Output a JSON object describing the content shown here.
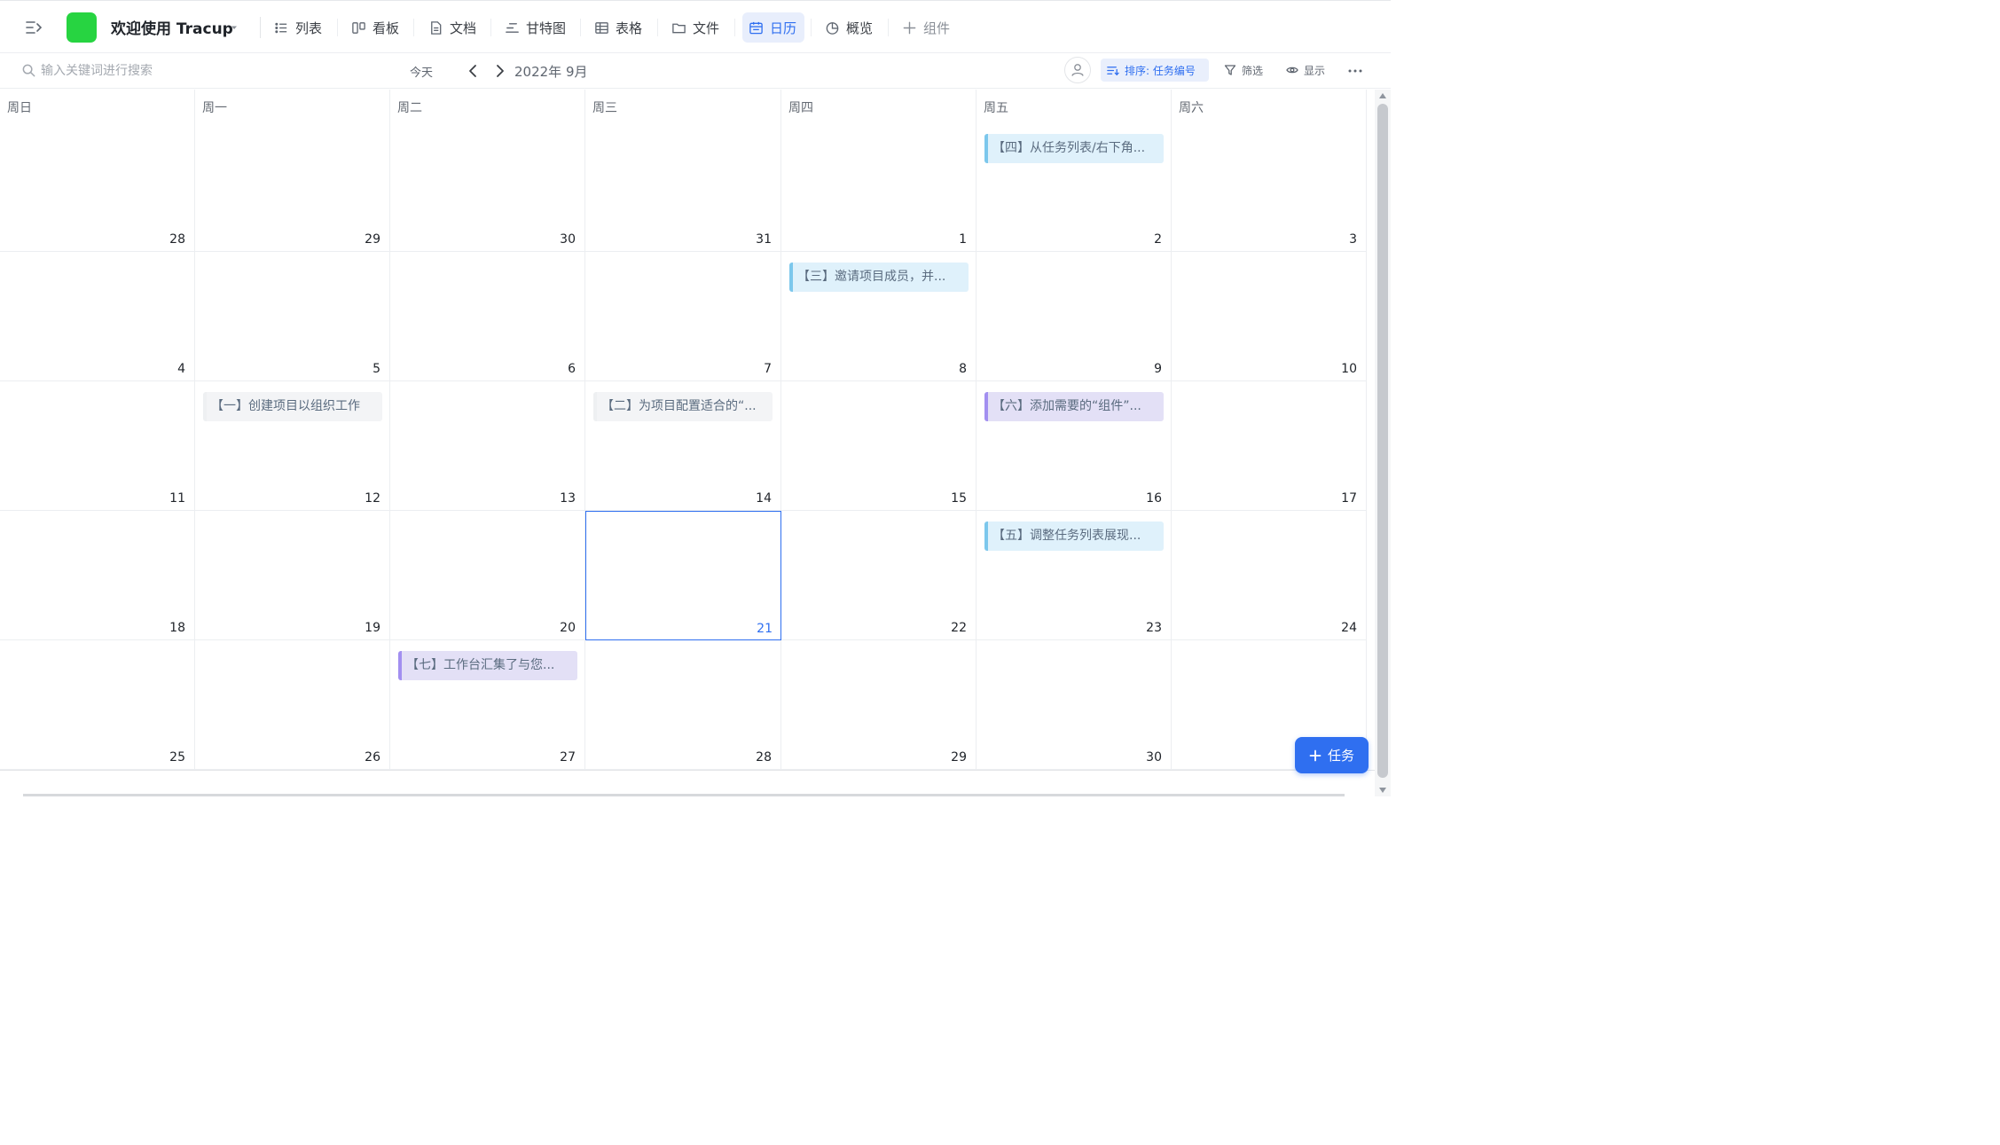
{
  "header": {
    "project_title": "欢迎使用 Tracup",
    "tabs": [
      {
        "label": "列表",
        "icon": "list-icon",
        "name": "tab-list"
      },
      {
        "label": "看板",
        "icon": "kanban-icon",
        "name": "tab-kanban"
      },
      {
        "label": "文档",
        "icon": "document-icon",
        "name": "tab-docs"
      },
      {
        "label": "甘特图",
        "icon": "gantt-icon",
        "name": "tab-gantt"
      },
      {
        "label": "表格",
        "icon": "table-icon",
        "name": "tab-table"
      },
      {
        "label": "文件",
        "icon": "folder-icon",
        "name": "tab-files"
      },
      {
        "label": "日历",
        "icon": "calendar-icon",
        "name": "tab-calendar",
        "active": true
      },
      {
        "label": "概览",
        "icon": "pie-chart-icon",
        "name": "tab-overview"
      },
      {
        "label": "组件",
        "icon": "plus-icon",
        "name": "tab-add-widget"
      }
    ]
  },
  "toolbar": {
    "search_placeholder": "输入关键词进行搜索",
    "today_label": "今天",
    "month_label": "2022年 9月",
    "sort_label": "排序: 任务编号",
    "filter_label": "筛选",
    "display_label": "显示"
  },
  "calendar": {
    "weekdays": [
      "周日",
      "周一",
      "周二",
      "周三",
      "周四",
      "周五",
      "周六"
    ],
    "weeks": [
      [
        28,
        29,
        30,
        31,
        1,
        2,
        3
      ],
      [
        4,
        5,
        6,
        7,
        8,
        9,
        10
      ],
      [
        11,
        12,
        13,
        14,
        15,
        16,
        17
      ],
      [
        18,
        19,
        20,
        21,
        22,
        23,
        24
      ],
      [
        25,
        26,
        27,
        28,
        29,
        30,
        null
      ]
    ],
    "today": 21,
    "events": [
      {
        "title": "【四】从任务列表/右下角...",
        "date": 2,
        "color": "blue"
      },
      {
        "title": "【三】邀请项目成员，并...",
        "date": 8,
        "color": "blue"
      },
      {
        "title": "【一】创建项目以组织工作",
        "date": 12,
        "color": "gray"
      },
      {
        "title": "【二】为项目配置适合的“...",
        "date": 14,
        "color": "gray"
      },
      {
        "title": "【六】添加需要的“组件”...",
        "date": 16,
        "color": "purple"
      },
      {
        "title": "【五】调整任务列表展现...",
        "date": 23,
        "color": "blue"
      },
      {
        "title": "【七】工作台汇集了与您...",
        "date": 27,
        "color": "purple"
      }
    ]
  },
  "add_task_label": "任务",
  "colors": {
    "accent": "#2f6ff0",
    "logo": "#27d441",
    "event_blue": "#dff1fb",
    "event_purple": "#e3e0f6",
    "event_gray": "#f3f4f6"
  }
}
